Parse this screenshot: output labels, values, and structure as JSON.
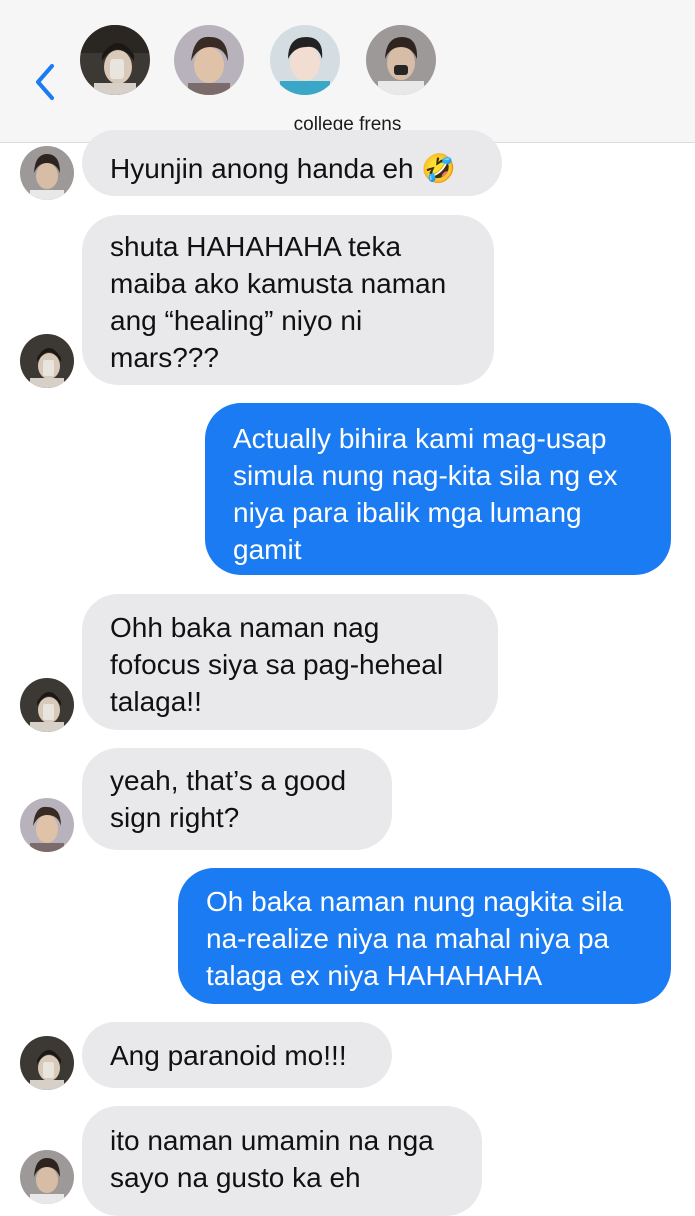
{
  "header": {
    "group_name": "college frens",
    "back_label": "back-chevron"
  },
  "messages": [
    {
      "side": "in",
      "text": "Hyunjin anong handa eh 🤣"
    },
    {
      "side": "in",
      "text": "shuta HAHAHAHA teka\nmaiba ako kamusta naman\nang “healing” niyo ni\nmars???"
    },
    {
      "side": "out",
      "text": "Actually bihira kami mag-usap\nsimula nung nag-kita sila ng ex\nniya para ibalik mga lumang\ngamit"
    },
    {
      "side": "in",
      "text": "Ohh baka naman nag\nfofocus siya sa pag-heheal\ntalaga!!"
    },
    {
      "side": "in",
      "text": "yeah, that’s a good\nsign right?"
    },
    {
      "side": "out",
      "text": "Oh baka naman nung nagkita sila\nna-realize niya na mahal niya pa\ntalaga ex niya HAHAHAHA"
    },
    {
      "side": "in",
      "text": "Ang paranoid mo!!!"
    },
    {
      "side": "in",
      "text": "ito naman umamin na nga\nsayo na gusto ka eh"
    }
  ],
  "colors": {
    "accent": "#1a7bf2",
    "incoming_bubble": "#e9e9eb",
    "header_bg": "#f6f6f6"
  }
}
